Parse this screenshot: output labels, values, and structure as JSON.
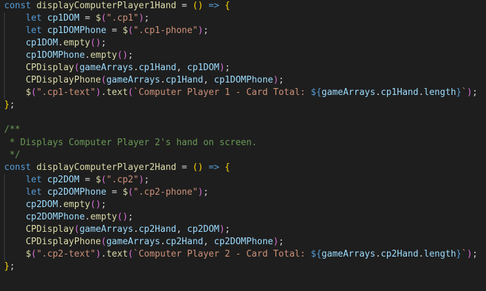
{
  "editor": {
    "background": "#1e1e1e",
    "lines": [
      {
        "indent": false,
        "tokens": [
          {
            "t": "const ",
            "c": "keyword"
          },
          {
            "t": "displayComputerPlayer1Hand",
            "c": "func"
          },
          {
            "t": " = ",
            "c": "plain"
          },
          {
            "t": "()",
            "c": "bracket1"
          },
          {
            "t": " => ",
            "c": "keyword"
          },
          {
            "t": "{",
            "c": "bracket1"
          }
        ]
      },
      {
        "indent": true,
        "tokens": [
          {
            "t": "let ",
            "c": "keyword"
          },
          {
            "t": "cp1DOM",
            "c": "var"
          },
          {
            "t": " = ",
            "c": "plain"
          },
          {
            "t": "$",
            "c": "func"
          },
          {
            "t": "(",
            "c": "bracket2"
          },
          {
            "t": "\".cp1\"",
            "c": "string"
          },
          {
            "t": ")",
            "c": "bracket2"
          },
          {
            "t": ";",
            "c": "plain"
          }
        ]
      },
      {
        "indent": true,
        "tokens": [
          {
            "t": "let ",
            "c": "keyword"
          },
          {
            "t": "cp1DOMPhone",
            "c": "var"
          },
          {
            "t": " = ",
            "c": "plain"
          },
          {
            "t": "$",
            "c": "func"
          },
          {
            "t": "(",
            "c": "bracket2"
          },
          {
            "t": "\".cp1-phone\"",
            "c": "string"
          },
          {
            "t": ")",
            "c": "bracket2"
          },
          {
            "t": ";",
            "c": "plain"
          }
        ]
      },
      {
        "indent": true,
        "tokens": [
          {
            "t": "cp1DOM",
            "c": "var"
          },
          {
            "t": ".",
            "c": "plain"
          },
          {
            "t": "empty",
            "c": "func"
          },
          {
            "t": "()",
            "c": "bracket2"
          },
          {
            "t": ";",
            "c": "plain"
          }
        ]
      },
      {
        "indent": true,
        "tokens": [
          {
            "t": "cp1DOMPhone",
            "c": "var"
          },
          {
            "t": ".",
            "c": "plain"
          },
          {
            "t": "empty",
            "c": "func"
          },
          {
            "t": "()",
            "c": "bracket2"
          },
          {
            "t": ";",
            "c": "plain"
          }
        ]
      },
      {
        "indent": true,
        "tokens": [
          {
            "t": "CPDisplay",
            "c": "func"
          },
          {
            "t": "(",
            "c": "bracket2"
          },
          {
            "t": "gameArrays",
            "c": "var"
          },
          {
            "t": ".",
            "c": "plain"
          },
          {
            "t": "cp1Hand",
            "c": "var"
          },
          {
            "t": ", ",
            "c": "plain"
          },
          {
            "t": "cp1DOM",
            "c": "var"
          },
          {
            "t": ")",
            "c": "bracket2"
          },
          {
            "t": ";",
            "c": "plain"
          }
        ]
      },
      {
        "indent": true,
        "tokens": [
          {
            "t": "CPDisplayPhone",
            "c": "func"
          },
          {
            "t": "(",
            "c": "bracket2"
          },
          {
            "t": "gameArrays",
            "c": "var"
          },
          {
            "t": ".",
            "c": "plain"
          },
          {
            "t": "cp1Hand",
            "c": "var"
          },
          {
            "t": ", ",
            "c": "plain"
          },
          {
            "t": "cp1DOMPhone",
            "c": "var"
          },
          {
            "t": ")",
            "c": "bracket2"
          },
          {
            "t": ";",
            "c": "plain"
          }
        ]
      },
      {
        "indent": true,
        "tokens": [
          {
            "t": "$",
            "c": "func"
          },
          {
            "t": "(",
            "c": "bracket2"
          },
          {
            "t": "\".cp1-text\"",
            "c": "string"
          },
          {
            "t": ")",
            "c": "bracket2"
          },
          {
            "t": ".",
            "c": "plain"
          },
          {
            "t": "text",
            "c": "func"
          },
          {
            "t": "(",
            "c": "bracket2"
          },
          {
            "t": "`Computer Player 1 - Card Total: ",
            "c": "string"
          },
          {
            "t": "${",
            "c": "interp"
          },
          {
            "t": "gameArrays",
            "c": "var"
          },
          {
            "t": ".",
            "c": "plain"
          },
          {
            "t": "cp1Hand",
            "c": "var"
          },
          {
            "t": ".",
            "c": "plain"
          },
          {
            "t": "length",
            "c": "var"
          },
          {
            "t": "}",
            "c": "interp"
          },
          {
            "t": "`",
            "c": "string"
          },
          {
            "t": ")",
            "c": "bracket2"
          },
          {
            "t": ";",
            "c": "plain"
          }
        ]
      },
      {
        "indent": false,
        "tokens": [
          {
            "t": "}",
            "c": "bracket1"
          },
          {
            "t": ";",
            "c": "plain"
          }
        ]
      },
      {
        "indent": false,
        "tokens": []
      },
      {
        "indent": false,
        "tokens": [
          {
            "t": "/**",
            "c": "comment"
          }
        ]
      },
      {
        "indent": false,
        "tokens": [
          {
            "t": " * Displays Computer Player 2's hand on screen.",
            "c": "comment"
          }
        ]
      },
      {
        "indent": false,
        "tokens": [
          {
            "t": " */",
            "c": "comment"
          }
        ]
      },
      {
        "indent": false,
        "tokens": [
          {
            "t": "const ",
            "c": "keyword"
          },
          {
            "t": "displayComputerPlayer2Hand",
            "c": "func"
          },
          {
            "t": " = ",
            "c": "plain"
          },
          {
            "t": "()",
            "c": "bracket1"
          },
          {
            "t": " => ",
            "c": "keyword"
          },
          {
            "t": "{",
            "c": "bracket1"
          }
        ]
      },
      {
        "indent": true,
        "tokens": [
          {
            "t": "let ",
            "c": "keyword"
          },
          {
            "t": "cp2DOM",
            "c": "var"
          },
          {
            "t": " = ",
            "c": "plain"
          },
          {
            "t": "$",
            "c": "func"
          },
          {
            "t": "(",
            "c": "bracket2"
          },
          {
            "t": "\".cp2\"",
            "c": "string"
          },
          {
            "t": ")",
            "c": "bracket2"
          },
          {
            "t": ";",
            "c": "plain"
          }
        ]
      },
      {
        "indent": true,
        "tokens": [
          {
            "t": "let ",
            "c": "keyword"
          },
          {
            "t": "cp2DOMPhone",
            "c": "var"
          },
          {
            "t": " = ",
            "c": "plain"
          },
          {
            "t": "$",
            "c": "func"
          },
          {
            "t": "(",
            "c": "bracket2"
          },
          {
            "t": "\".cp2-phone\"",
            "c": "string"
          },
          {
            "t": ")",
            "c": "bracket2"
          },
          {
            "t": ";",
            "c": "plain"
          }
        ]
      },
      {
        "indent": true,
        "tokens": [
          {
            "t": "cp2DOM",
            "c": "var"
          },
          {
            "t": ".",
            "c": "plain"
          },
          {
            "t": "empty",
            "c": "func"
          },
          {
            "t": "()",
            "c": "bracket2"
          },
          {
            "t": ";",
            "c": "plain"
          }
        ]
      },
      {
        "indent": true,
        "tokens": [
          {
            "t": "cp2DOMPhone",
            "c": "var"
          },
          {
            "t": ".",
            "c": "plain"
          },
          {
            "t": "empty",
            "c": "func"
          },
          {
            "t": "()",
            "c": "bracket2"
          },
          {
            "t": ";",
            "c": "plain"
          }
        ]
      },
      {
        "indent": true,
        "tokens": [
          {
            "t": "CPDisplay",
            "c": "func"
          },
          {
            "t": "(",
            "c": "bracket2"
          },
          {
            "t": "gameArrays",
            "c": "var"
          },
          {
            "t": ".",
            "c": "plain"
          },
          {
            "t": "cp2Hand",
            "c": "var"
          },
          {
            "t": ", ",
            "c": "plain"
          },
          {
            "t": "cp2DOM",
            "c": "var"
          },
          {
            "t": ")",
            "c": "bracket2"
          },
          {
            "t": ";",
            "c": "plain"
          }
        ]
      },
      {
        "indent": true,
        "tokens": [
          {
            "t": "CPDisplayPhone",
            "c": "func"
          },
          {
            "t": "(",
            "c": "bracket2"
          },
          {
            "t": "gameArrays",
            "c": "var"
          },
          {
            "t": ".",
            "c": "plain"
          },
          {
            "t": "cp2Hand",
            "c": "var"
          },
          {
            "t": ", ",
            "c": "plain"
          },
          {
            "t": "cp2DOMPhone",
            "c": "var"
          },
          {
            "t": ")",
            "c": "bracket2"
          },
          {
            "t": ";",
            "c": "plain"
          }
        ]
      },
      {
        "indent": true,
        "tokens": [
          {
            "t": "$",
            "c": "func"
          },
          {
            "t": "(",
            "c": "bracket2"
          },
          {
            "t": "\".cp2-text\"",
            "c": "string"
          },
          {
            "t": ")",
            "c": "bracket2"
          },
          {
            "t": ".",
            "c": "plain"
          },
          {
            "t": "text",
            "c": "func"
          },
          {
            "t": "(",
            "c": "bracket2"
          },
          {
            "t": "`Computer Player 2 - Card Total: ",
            "c": "string"
          },
          {
            "t": "${",
            "c": "interp"
          },
          {
            "t": "gameArrays",
            "c": "var"
          },
          {
            "t": ".",
            "c": "plain"
          },
          {
            "t": "cp2Hand",
            "c": "var"
          },
          {
            "t": ".",
            "c": "plain"
          },
          {
            "t": "length",
            "c": "var"
          },
          {
            "t": "}",
            "c": "interp"
          },
          {
            "t": "`",
            "c": "string"
          },
          {
            "t": ")",
            "c": "bracket2"
          },
          {
            "t": ";",
            "c": "plain"
          }
        ]
      },
      {
        "indent": false,
        "tokens": [
          {
            "t": "}",
            "c": "bracket1"
          },
          {
            "t": ";",
            "c": "plain"
          }
        ]
      },
      {
        "indent": false,
        "tokens": []
      }
    ]
  }
}
